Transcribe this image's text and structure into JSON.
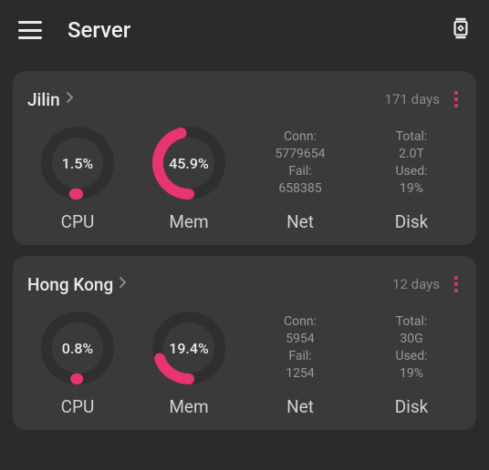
{
  "header": {
    "title": "Server"
  },
  "accent_color": "#e83471",
  "servers": [
    {
      "name": "Jilin",
      "uptime": "171 days",
      "cpu": {
        "percent": 1.5,
        "display": "1.5%"
      },
      "mem": {
        "percent": 45.9,
        "display": "45.9%"
      },
      "net": {
        "conn_label": "Conn:",
        "conn_value": "5779654",
        "fail_label": "Fail:",
        "fail_value": "658385"
      },
      "disk": {
        "total_label": "Total:",
        "total_value": "2.0T",
        "used_label": "Used:",
        "used_value": "19%"
      },
      "labels": {
        "cpu": "CPU",
        "mem": "Mem",
        "net": "Net",
        "disk": "Disk"
      }
    },
    {
      "name": "Hong Kong",
      "uptime": "12 days",
      "cpu": {
        "percent": 0.8,
        "display": "0.8%"
      },
      "mem": {
        "percent": 19.4,
        "display": "19.4%"
      },
      "net": {
        "conn_label": "Conn:",
        "conn_value": "5954",
        "fail_label": "Fail:",
        "fail_value": "1254"
      },
      "disk": {
        "total_label": "Total:",
        "total_value": "30G",
        "used_label": "Used:",
        "used_value": "19%"
      },
      "labels": {
        "cpu": "CPU",
        "mem": "Mem",
        "net": "Net",
        "disk": "Disk"
      }
    }
  ]
}
